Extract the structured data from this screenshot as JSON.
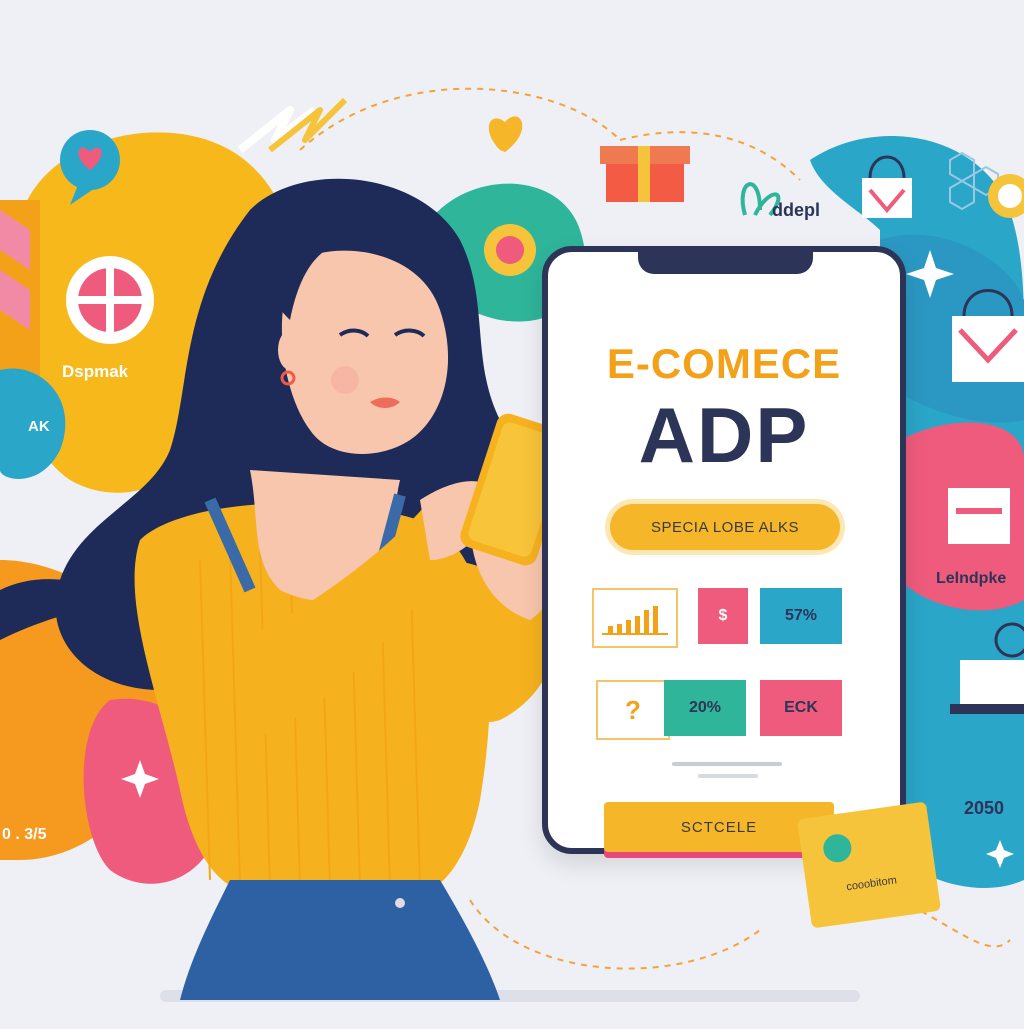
{
  "phone_screen": {
    "headline": "E-COMECE",
    "title": "ADP",
    "promo_button": "SPECIA LOBE ALKS",
    "tiles": [
      {
        "label": "",
        "kind": "chart"
      },
      {
        "label": "$",
        "kind": "price"
      },
      {
        "label": "57%",
        "kind": "percent"
      },
      {
        "label": "?",
        "kind": "question"
      },
      {
        "label": "20%",
        "kind": "percent"
      },
      {
        "label": "ECK",
        "kind": "text"
      }
    ]
  },
  "cta_button": "SCTCELE",
  "card_text": "cooobitom",
  "bubbles": {
    "left_top_label": "Dspmak",
    "left_mid_label": "AK",
    "left_bottom_label": "0 . 3/5",
    "right_top_label": "ddepl",
    "right_mid_label": "Lelndpke",
    "right_bottom_label": "2050"
  },
  "colors": {
    "orange": "#f4a11a",
    "yellow": "#f6b62a",
    "navy": "#2c3557",
    "pink": "#ef5b7c",
    "teal": "#2aa6c9",
    "green": "#2fb59a"
  }
}
